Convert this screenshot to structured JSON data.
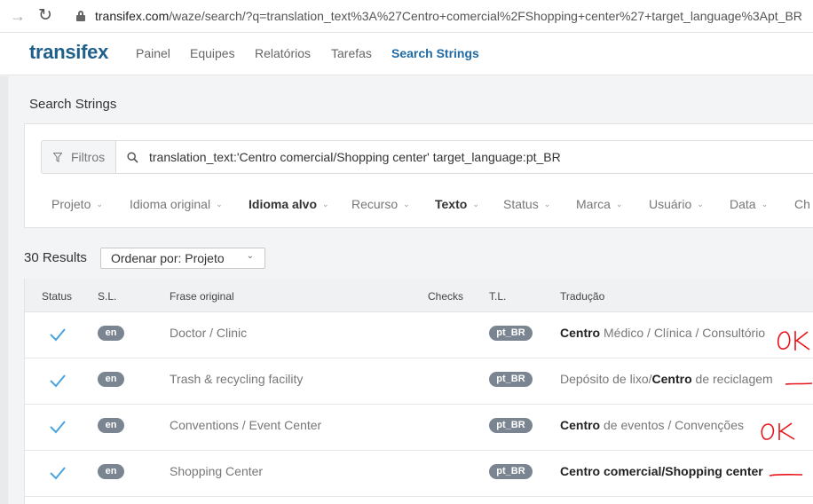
{
  "browser": {
    "url_host": "transifex.com",
    "url_path": "/waze/search/?q=translation_text%3A%27Centro+comercial%2FShopping+center%27+target_language%3Apt_BR",
    "forward_icon": "arrow-forward-icon",
    "reload_icon": "reload-icon",
    "lock_icon": "lock-icon"
  },
  "header": {
    "logo": "transifex",
    "nav": [
      "Painel",
      "Equipes",
      "Relatórios",
      "Tarefas",
      "Search Strings"
    ],
    "active_index": 4
  },
  "search": {
    "title": "Search Strings",
    "filter_label": "Filtros",
    "query": "translation_text:'Centro comercial/Shopping center' target_language:pt_BR",
    "facets": [
      "Projeto",
      "Idioma original",
      "Idioma alvo",
      "Recurso",
      "Texto",
      "Status",
      "Marca",
      "Usuário",
      "Data",
      "Ch"
    ]
  },
  "results": {
    "count_label": "30 Results",
    "order_label": "Ordenar por: Projeto"
  },
  "table": {
    "headers": {
      "status": "Status",
      "sl": "S.L.",
      "source": "Frase original",
      "checks": "Checks",
      "tl": "T.L.",
      "translation": "Tradução"
    },
    "rows": [
      {
        "sl": "en",
        "source": "Doctor / Clinic",
        "tl": "pt_BR",
        "tr_parts": [
          {
            "t": "Centro",
            "b": true
          },
          {
            "t": " Médico / Clínica / Consultório",
            "b": false
          }
        ]
      },
      {
        "sl": "en",
        "source": "Trash & recycling facility",
        "tl": "pt_BR",
        "tr_parts": [
          {
            "t": "Depósito de lixo/",
            "b": false
          },
          {
            "t": "Centro",
            "b": true
          },
          {
            "t": " de reciclagem",
            "b": false
          }
        ]
      },
      {
        "sl": "en",
        "source": "Conventions / Event Center",
        "tl": "pt_BR",
        "tr_parts": [
          {
            "t": "Centro",
            "b": true
          },
          {
            "t": " de eventos / Convenções",
            "b": false
          }
        ]
      },
      {
        "sl": "en",
        "source": "Shopping Center",
        "tl": "pt_BR",
        "tr_parts": [
          {
            "t": "Centro comercial/Shopping center",
            "b": true
          }
        ]
      }
    ]
  },
  "annotations": {
    "ok_text": "OK",
    "color": "#e8141b"
  },
  "colors": {
    "accent": "#1f6aa5",
    "check": "#4aa3df",
    "badge": "#7b8591"
  }
}
